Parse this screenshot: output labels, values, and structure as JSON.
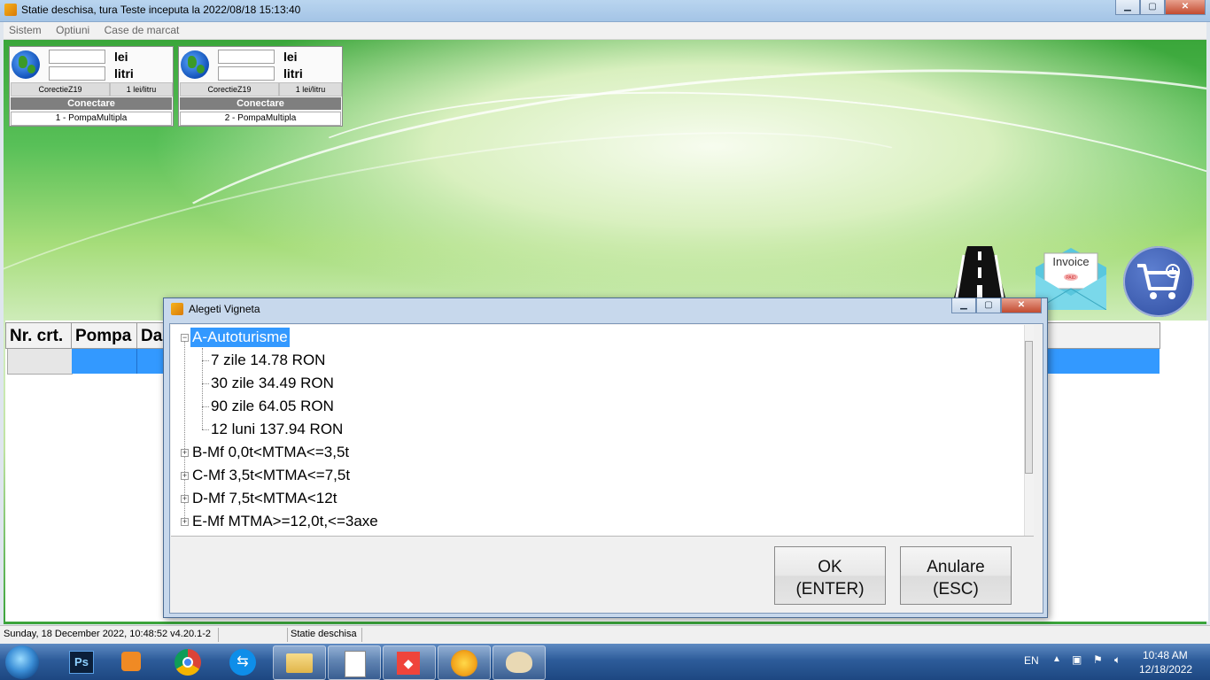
{
  "window": {
    "title": "Statie deschisa, tura Teste inceputa la 2022/08/18 15:13:40",
    "min": "▁",
    "max": "▢",
    "close": "✕"
  },
  "menu": {
    "items": [
      "Sistem",
      "Optiuni",
      "Case de marcat"
    ]
  },
  "pumps": [
    {
      "unit_money": "lei",
      "unit_volume": "litri",
      "correction": "CorectieZ19",
      "price": "1 lei/litru",
      "connect": "Conectare",
      "name": "1 - PompaMultipla"
    },
    {
      "unit_money": "lei",
      "unit_volume": "litri",
      "correction": "CorectieZ19",
      "price": "1 lei/litru",
      "connect": "Conectare",
      "name": "2 - PompaMultipla"
    }
  ],
  "icons": {
    "invoice_label": "Invoice",
    "invoice_badge": "PAID"
  },
  "grid": {
    "columns": [
      "Nr. crt.",
      "Pompa",
      "Da"
    ]
  },
  "dialog": {
    "title": "Alegeti Vigneta",
    "tree": [
      {
        "label": "A-Autoturisme",
        "expanded": true,
        "selected": true,
        "children": [
          "7 zile 14.78 RON",
          "30 zile 34.49 RON",
          "90 zile 64.05 RON",
          "12 luni 137.94 RON"
        ]
      },
      {
        "label": "B-Mf 0,0t<MTMA<=3,5t",
        "expanded": false
      },
      {
        "label": "C-Mf 3,5t<MTMA<=7,5t",
        "expanded": false
      },
      {
        "label": "D-Mf 7,5t<MTMA<12t",
        "expanded": false
      },
      {
        "label": "E-Mf MTMA>=12,0t,<=3axe",
        "expanded": false
      }
    ],
    "ok": {
      "line1": "OK",
      "line2": "(ENTER)"
    },
    "cancel": {
      "line1": "Anulare",
      "line2": "(ESC)"
    }
  },
  "statusbar": {
    "datetime": "Sunday, 18 December 2022, 10:48:52 v4.20.1-2",
    "state": "Statie deschisa"
  },
  "taskbar": {
    "lang": "EN",
    "time": "10:48 AM",
    "date": "12/18/2022",
    "ps": "Ps"
  }
}
